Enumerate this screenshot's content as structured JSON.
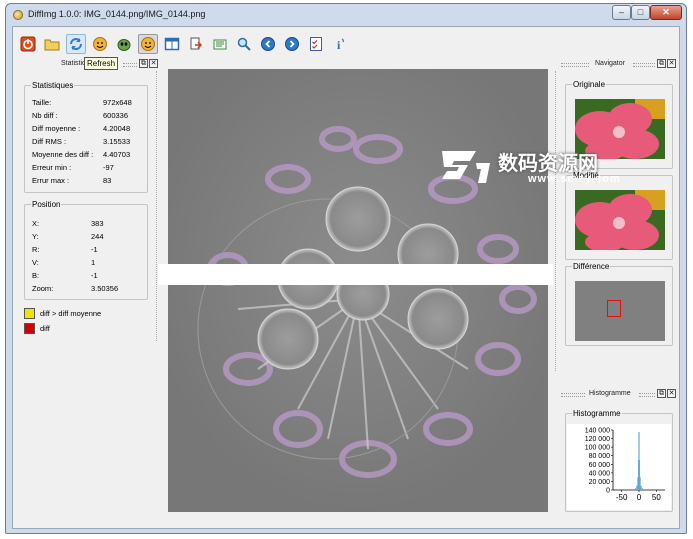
{
  "window": {
    "title": "DiffImg 1.0.0: IMG_0144.png/IMG_0144.png"
  },
  "controls": {
    "minimize": "–",
    "maximize": "□",
    "close": "✕"
  },
  "toolbar": {
    "icons": [
      "power-icon",
      "open-folder-icon",
      "refresh-icon",
      "smiley-icon",
      "alien-icon",
      "smiley-active-icon",
      "layout-icon",
      "export-icon",
      "binoculars-icon",
      "magnifier-icon",
      "prev-icon",
      "next-icon",
      "checklist-icon",
      "info-icon"
    ],
    "tooltip": "Refresh"
  },
  "panels": {
    "statistics": {
      "dock_title": "Statistic",
      "group_title": "Statistiques",
      "rows": [
        {
          "label": "Taille:",
          "value": "972x648"
        },
        {
          "label": "Nb diff :",
          "value": "600336"
        },
        {
          "label": "Diff moyenne :",
          "value": "4.20048"
        },
        {
          "label": "Diff RMS :",
          "value": "3.15533"
        },
        {
          "label": "Moyenne des diff :",
          "value": "4.40703"
        },
        {
          "label": "Erreur min :",
          "value": "-97"
        },
        {
          "label": "Errur max :",
          "value": "83"
        }
      ]
    },
    "position": {
      "group_title": "Position",
      "rows": [
        {
          "label": "X:",
          "value": "383"
        },
        {
          "label": "Y:",
          "value": "244"
        },
        {
          "label": "R:",
          "value": "-1"
        },
        {
          "label": "V:",
          "value": "1"
        },
        {
          "label": "B:",
          "value": "-1"
        },
        {
          "label": "Zoom:",
          "value": "3.50356"
        }
      ]
    },
    "legend": [
      {
        "color": "#f4e200",
        "label": "diff > diff moyenne"
      },
      {
        "color": "#d40000",
        "label": "diff"
      }
    ],
    "navigator": {
      "dock_title": "Navigator",
      "original": "Originale",
      "modified": "Modifié",
      "difference": "Différence"
    },
    "histogram": {
      "dock_title": "Histogramme",
      "group_title": "Histogramme"
    }
  },
  "chart_data": {
    "type": "bar",
    "title": "",
    "y_ticks": [
      "140 000",
      "120 000",
      "100 000",
      "80 000",
      "60 000",
      "40 000",
      "20 000",
      "0"
    ],
    "x_ticks": [
      "-50",
      "0",
      "50"
    ],
    "ylim": [
      0,
      140000
    ],
    "xlim": [
      -75,
      75
    ],
    "series": [
      {
        "x": [
          -10,
          -6,
          -3,
          -1,
          0,
          1,
          3,
          6,
          10
        ],
        "values": [
          4000,
          10000,
          30000,
          70000,
          135000,
          70000,
          30000,
          10000,
          4000
        ],
        "color": "#5fa8d8"
      }
    ]
  },
  "watermark": {
    "text": "数码资源网",
    "url": "www.smzy.com"
  }
}
